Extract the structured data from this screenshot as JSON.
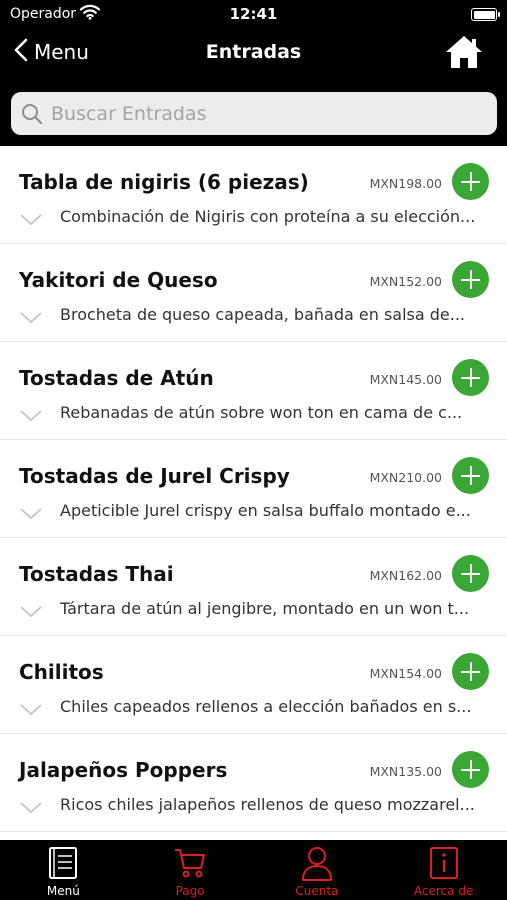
{
  "status_bar": {
    "carrier": "Operador",
    "time": "12:41",
    "battery_level": 1.0
  },
  "nav": {
    "back_label": "Menu",
    "title": "Entradas"
  },
  "search": {
    "placeholder": "Buscar Entradas"
  },
  "items": [
    {
      "name": "Tabla de nigiris (6 piezas)",
      "price": "MXN198.00",
      "description": "Combinación de Nigiris con proteína a su elección..."
    },
    {
      "name": "Yakitori de Queso",
      "price": "MXN152.00",
      "description": "Brocheta de queso capeada, bañada en salsa de..."
    },
    {
      "name": "Tostadas de Atún",
      "price": "MXN145.00",
      "description": "Rebanadas de atún sobre won ton en cama de c..."
    },
    {
      "name": "Tostadas de Jurel Crispy",
      "price": "MXN210.00",
      "description": "Apeticible Jurel crispy en salsa buffalo montado e..."
    },
    {
      "name": "Tostadas Thai",
      "price": "MXN162.00",
      "description": "Tártara de atún al jengibre, montado en un won t..."
    },
    {
      "name": "Chilitos",
      "price": "MXN154.00",
      "description": "Chiles capeados rellenos a elección bañados en s..."
    },
    {
      "name": "Jalapeños Poppers",
      "price": "MXN135.00",
      "description": "Ricos chiles jalapeños rellenos de queso mozzarel..."
    }
  ],
  "tabs": [
    {
      "label": "Menú",
      "icon": "menu-book-icon",
      "active": true
    },
    {
      "label": "Pago",
      "icon": "cart-icon",
      "active": false
    },
    {
      "label": "Cuenta",
      "icon": "user-icon",
      "active": false
    },
    {
      "label": "Acerca de",
      "icon": "info-icon",
      "active": false
    }
  ],
  "colors": {
    "accent_green": "#3aa635",
    "tab_inactive_red": "#d91f1f",
    "bar_background": "#000000"
  }
}
